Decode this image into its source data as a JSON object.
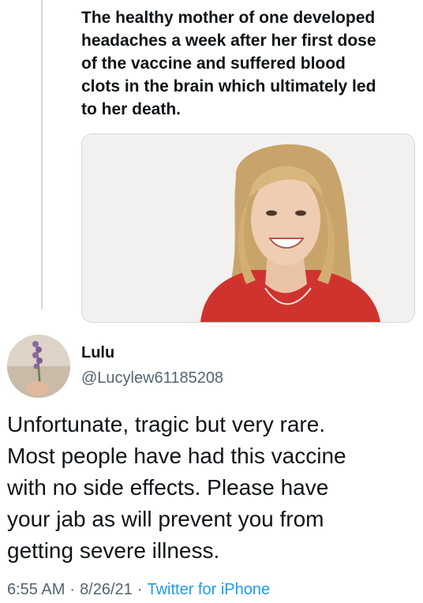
{
  "quoted_tweet": {
    "text": "The healthy mother of one developed\nheadaches a week after her first dose\nof the vaccine and suffered blood\nclots in the brain which ultimately led\nto her death.",
    "image": {
      "subject": "smiling woman with shoulder-length blonde hair in a red top",
      "background_color": "#f2f1ef",
      "top_color": "#d0332d"
    }
  },
  "tweet": {
    "display_name": "Lulu",
    "handle": "@Lucylew61185208",
    "avatar": {
      "subject": "hand holding a sprig of lavender"
    },
    "text": "Unfortunate, tragic but very rare.\nMost people have had this vaccine\nwith no side effects. Please have\nyour jab as will prevent you from\ngetting severe illness.",
    "time": "6:55 AM",
    "date": "8/26/21",
    "separator": "·",
    "source": "Twitter for iPhone"
  },
  "colors": {
    "text_primary": "#0f1419",
    "text_secondary": "#536471",
    "link": "#1d9bf0",
    "thread_line": "#cfd9de"
  }
}
